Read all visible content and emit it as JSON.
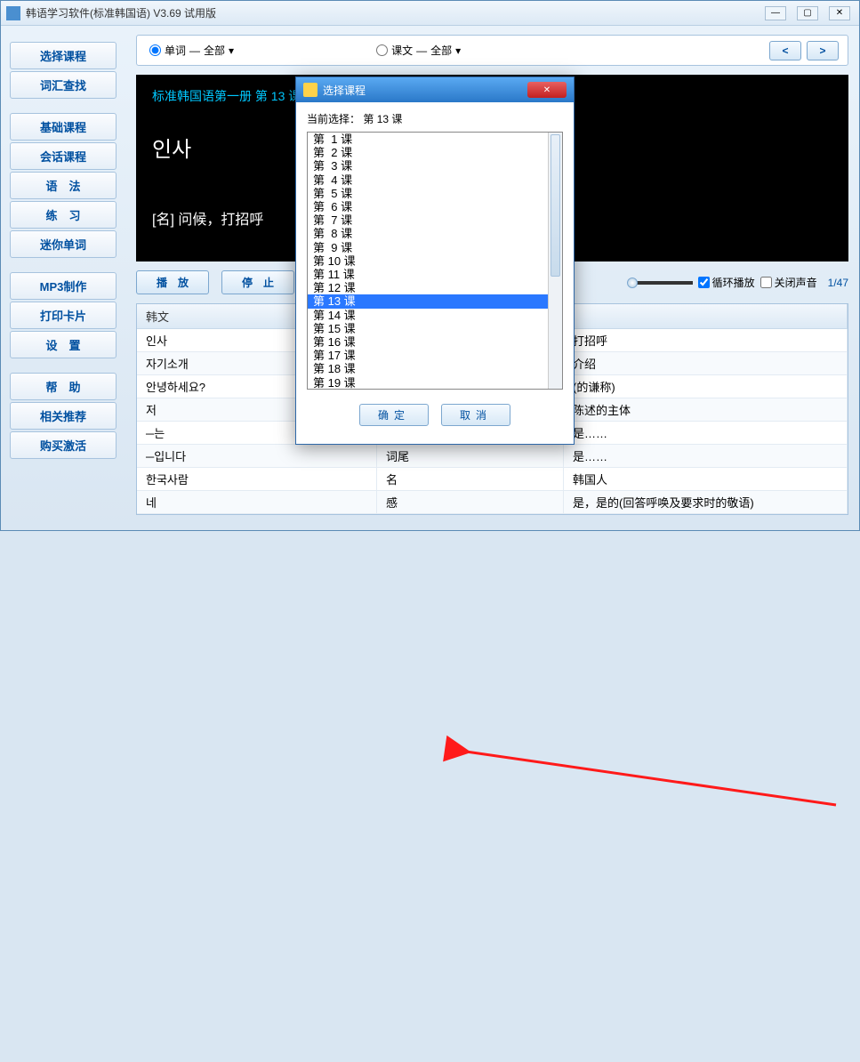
{
  "window": {
    "title": "韩语学习软件(标准韩国语) V3.69 试用版"
  },
  "sidebar": {
    "g1": [
      "选择课程",
      "词汇查找"
    ],
    "g2": [
      "基础课程",
      "会话课程",
      "语　法",
      "练　习",
      "迷你单词"
    ],
    "g3": [
      "MP3制作",
      "打印卡片",
      "设　置"
    ],
    "g4": [
      "帮　助",
      "相关推荐",
      "购买激活"
    ]
  },
  "filter": {
    "opt1_label": "单词",
    "opt1_scope": "全部",
    "opt2_label": "课文",
    "opt2_scope": "全部",
    "nav_prev": "<",
    "nav_next": ">"
  },
  "black": {
    "title": "标准韩国语第一册 第 13 课",
    "kr": "인사",
    "desc": "[名]  问候，打招呼"
  },
  "controls": {
    "play": "播　放",
    "stop": "停　止",
    "loop": "循环播放",
    "mute": "关闭声音",
    "counter": "1/47"
  },
  "table": {
    "headers": [
      "韩文",
      "",
      ""
    ],
    "rows": [
      [
        "인사",
        "",
        "打招呼"
      ],
      [
        "자기소개",
        "",
        "介绍"
      ],
      [
        "안녕하세요?",
        "",
        "(的谦称)"
      ],
      [
        "저",
        "",
        "陈述的主体"
      ],
      [
        "─는",
        "",
        "是……"
      ],
      [
        "─입니다",
        "词尾",
        "是……"
      ],
      [
        "한국사람",
        "名",
        "韩国人"
      ],
      [
        "네",
        "感",
        "是，是的(回答呼唤及要求时的敬语)"
      ]
    ]
  },
  "dialog": {
    "title": "选择课程",
    "current_label": "当前选择：",
    "current_value": "第 13 课",
    "items": [
      "第  1 课",
      "第  2 课",
      "第  3 课",
      "第  4 课",
      "第  5 课",
      "第  6 课",
      "第  7 课",
      "第  8 课",
      "第  9 课",
      "第 10 课",
      "第 11 课",
      "第 12 课",
      "第 13 课",
      "第 14 课",
      "第 15 课",
      "第 16 课",
      "第 17 课",
      "第 18 课",
      "第 19 课"
    ],
    "selected_index": 12,
    "ok": "确定",
    "cancel": "取消"
  }
}
